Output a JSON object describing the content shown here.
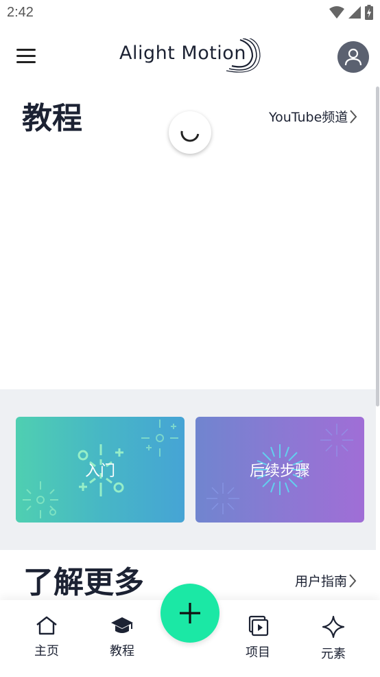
{
  "status_bar": {
    "time": "2:42"
  },
  "app_bar": {
    "logo_text": "Alight Motion",
    "menu_icon": "hamburger-menu-icon",
    "profile_icon": "person-icon"
  },
  "tutorials": {
    "title": "教程",
    "link_label": "YouTube频道",
    "cards": [
      {
        "label": "入门",
        "gradient": [
          "#4fcfb1",
          "#46a4d5"
        ]
      },
      {
        "label": "后续步骤",
        "gradient": [
          "#7085cf",
          "#a06ed6"
        ]
      }
    ]
  },
  "learn_more": {
    "title": "了解更多",
    "link_label": "用户指南"
  },
  "bottom_nav": {
    "items": [
      {
        "label": "主页",
        "icon": "home-icon"
      },
      {
        "label": "教程",
        "icon": "graduation-cap-icon"
      },
      {
        "label": "项目",
        "icon": "projects-icon"
      },
      {
        "label": "元素",
        "icon": "sparkle-icon"
      }
    ],
    "fab_icon": "plus-icon"
  },
  "colors": {
    "accent": "#1be8a5",
    "text": "#1c2233",
    "band_background": "#eef0f3",
    "avatar": "#5b6170"
  }
}
